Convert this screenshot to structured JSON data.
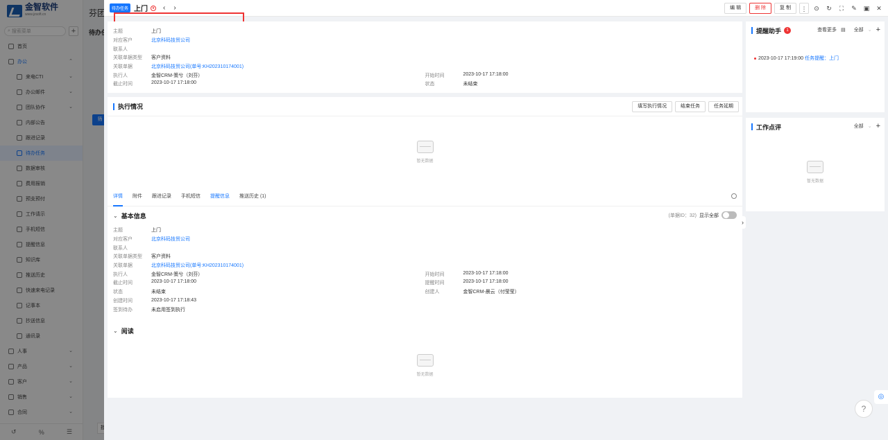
{
  "sidebar": {
    "logo": {
      "name": "金智软件",
      "sub": "www.jzsoft.cn"
    },
    "search_placeholder": "搜索菜单",
    "items": [
      {
        "label": "首页",
        "level": 0
      },
      {
        "label": "办公",
        "level": 0,
        "open": true
      },
      {
        "label": "来电CTI",
        "level": 1
      },
      {
        "label": "办公邮件",
        "level": 1
      },
      {
        "label": "团队协作",
        "level": 1
      },
      {
        "label": "内部公告",
        "level": 1
      },
      {
        "label": "跟进记录",
        "level": 1
      },
      {
        "label": "待办任务",
        "level": 1,
        "active": true
      },
      {
        "label": "数据审核",
        "level": 1
      },
      {
        "label": "费用报销",
        "level": 1
      },
      {
        "label": "预支预付",
        "level": 1
      },
      {
        "label": "工作请示",
        "level": 1
      },
      {
        "label": "手机短信",
        "level": 1
      },
      {
        "label": "提醒信息",
        "level": 1
      },
      {
        "label": "知识库",
        "level": 1
      },
      {
        "label": "推送历史",
        "level": 1
      },
      {
        "label": "快速来电记录",
        "level": 1
      },
      {
        "label": "记事本",
        "level": 1
      },
      {
        "label": "抄送信息",
        "level": 1
      },
      {
        "label": "通讯录",
        "level": 1
      },
      {
        "label": "人事",
        "level": 0
      },
      {
        "label": "产品",
        "level": 0
      },
      {
        "label": "客户",
        "level": 0
      },
      {
        "label": "销售",
        "level": 0
      },
      {
        "label": "合同",
        "level": 0
      }
    ]
  },
  "bg": {
    "title": "芬团",
    "list_title": "待办任",
    "btn": "筛",
    "foot": "批"
  },
  "drawer": {
    "tag": "待办任务",
    "title": "上门",
    "star": "★",
    "prev": "‹",
    "next": "›",
    "actions": {
      "edit": "编 辑",
      "delete": "删 除",
      "copy": "复 制"
    },
    "icons": [
      "more-icon",
      "settings-icon",
      "refresh-icon",
      "fullscreen-icon",
      "pencil-icon",
      "save-icon",
      "close-icon"
    ]
  },
  "info": {
    "subject_label": "主题",
    "subject": "上门",
    "customer_label": "对应客户",
    "customer": "北京科码技贸公司",
    "contact_label": "联系人",
    "contact": "",
    "rel_type_label": "关联单据类型",
    "rel_type": "客户资料",
    "rel_doc_label": "关联单据",
    "rel_doc": "北京科码技贸公司(单号:KH202310174001)",
    "executor_label": "执行人",
    "executor": "金智CRM-策兮（刘芬）",
    "start_label": "开始时间",
    "start": "2023-10-17 17:18:00",
    "deadline_label": "截止时间",
    "deadline": "2023-10-17 17:18:00",
    "status_label": "状态",
    "status": "未结束"
  },
  "execution": {
    "title": "执行情况",
    "buttons": [
      "填写执行情况",
      "结束任务",
      "任务延期"
    ],
    "empty": "暂无数据"
  },
  "tabs": [
    "详情",
    "附件",
    "跟进记录",
    "手机短信",
    "提醒信息",
    "推送历史 (1)"
  ],
  "basic": {
    "title": "基本信息",
    "doc_id": "(单据ID：32)",
    "show_all": "显示全部",
    "subject_label": "主题",
    "subject": "上门",
    "customer_label": "对应客户",
    "customer": "北京科码技贸公司",
    "contact_label": "联系人",
    "contact": "",
    "rel_type_label": "关联单据类型",
    "rel_type": "客户资料",
    "rel_doc_label": "关联单据",
    "rel_doc": "北京科码技贸公司(单号:KH202310174001)",
    "executor_label": "执行人",
    "executor": "金智CRM-策兮（刘芬）",
    "start_label": "开始时间",
    "start": "2023-10-17 17:18:00",
    "deadline_label": "截止时间",
    "deadline": "2023-10-17 17:18:00",
    "remind_label": "提醒时间",
    "remind": "2023-10-17 17:18:00",
    "status_label": "状态",
    "status": "未结束",
    "creator_label": "创建人",
    "creator": "金智CRM-晨云（付莹莹）",
    "created_label": "创建时间",
    "created": "2023-10-17 17:18:43",
    "checkin_label": "签到待办",
    "checkin": "未启用签到执行"
  },
  "read": {
    "title": "阅读",
    "empty": "暂无数据"
  },
  "reminder": {
    "title": "提醒助手",
    "badge": "1",
    "more": "查看更多",
    "filter": "全部",
    "item_time": "2023-10-17 17:19:00",
    "item_text": "任务提醒：上门"
  },
  "review": {
    "title": "工作点评",
    "filter": "全部",
    "empty": "暂无数据"
  },
  "help": "?"
}
